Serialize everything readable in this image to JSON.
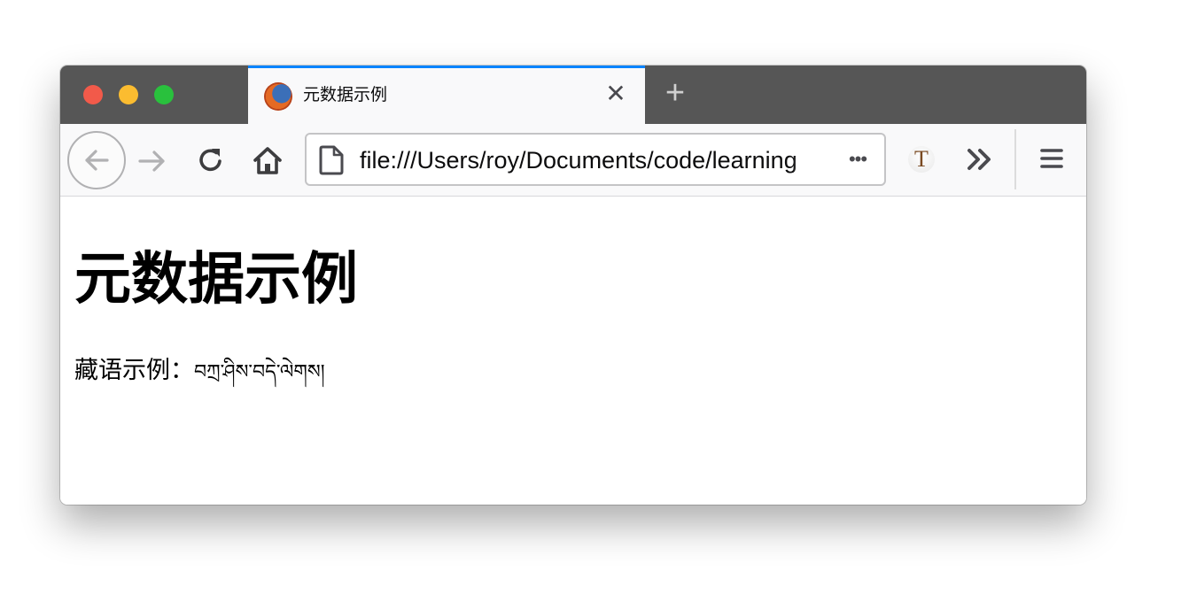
{
  "window": {
    "traffic_lights": [
      "close",
      "minimize",
      "zoom"
    ]
  },
  "tabs": [
    {
      "title": "元数据示例",
      "favicon": "firefox-icon",
      "active": true,
      "close_glyph": "✕"
    }
  ],
  "new_tab_glyph": "+",
  "toolbar": {
    "back_icon": "arrow-left-icon",
    "forward_icon": "arrow-right-icon",
    "reload_icon": "reload-icon",
    "home_icon": "home-icon",
    "url": "file:///Users/roy/Documents/code/learning",
    "page_icon": "page-icon",
    "page_actions_glyph": "•••",
    "extension_glyph": "T",
    "overflow_icon": "double-chevron-icon",
    "menu_icon": "hamburger-icon"
  },
  "colors": {
    "tab_accent": "#0a84ff",
    "tabbar_bg": "#565656",
    "toolbar_bg": "#f9f9fa",
    "traffic_red": "#f25a4a",
    "traffic_yellow": "#fbbc30",
    "traffic_green": "#29c13d"
  },
  "page": {
    "heading": "元数据示例",
    "paragraph_label": "藏语示例：",
    "paragraph_tibetan": "བཀྲ་ཤིས་བདེ་ལེགས།"
  }
}
